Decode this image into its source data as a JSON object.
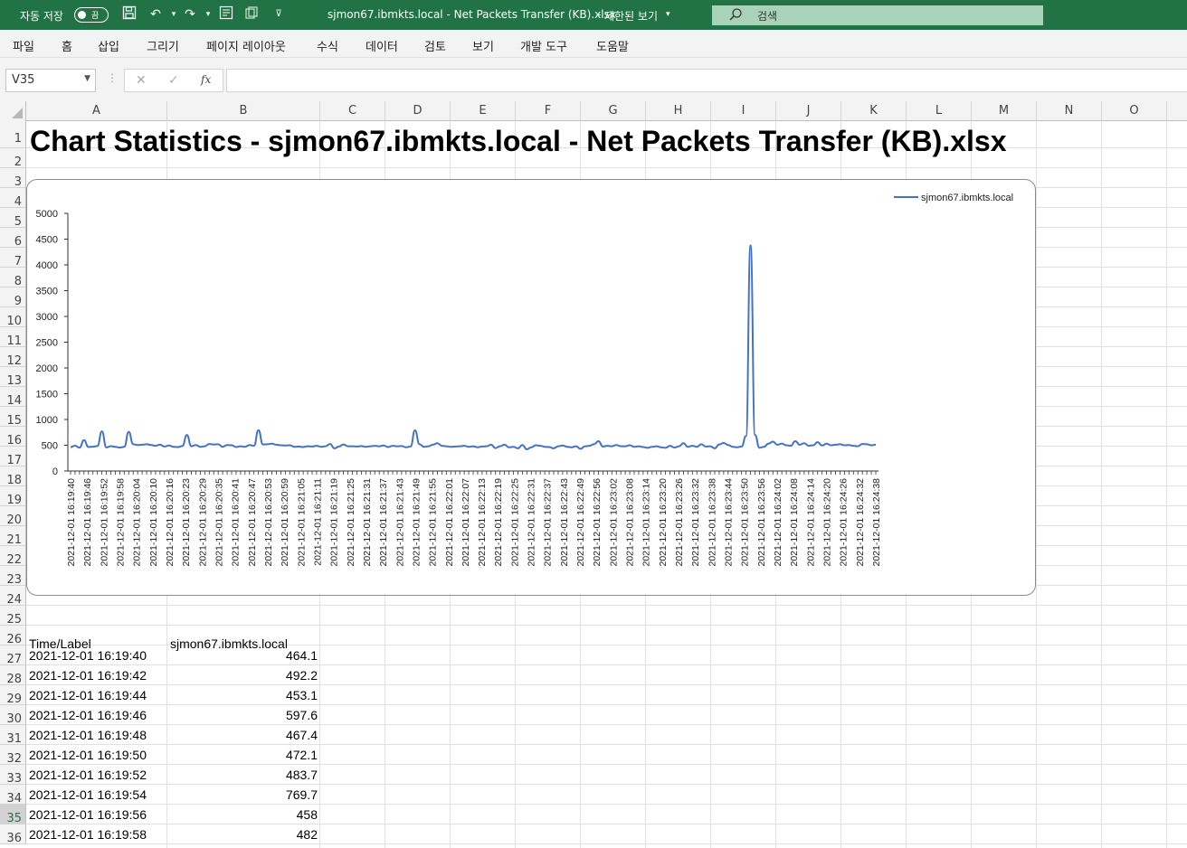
{
  "titlebar": {
    "autosave_label": "자동 저장",
    "autosave_state": "끔",
    "doc_title": "sjmon67.ibmkts.local - Net Packets Transfer (KB).xlsx",
    "view_mode": "제한된 보기",
    "search_placeholder": "검색",
    "bg_color": "#217346"
  },
  "menu": {
    "items": [
      "파일",
      "홈",
      "삽입",
      "그리기",
      "페이지 레이아웃",
      "수식",
      "데이터",
      "검토",
      "보기",
      "개발 도구",
      "도움말"
    ]
  },
  "formula_bar": {
    "name_box": "V35",
    "fx_label": "fx",
    "formula": ""
  },
  "sheet": {
    "columns": [
      "A",
      "B",
      "C",
      "D",
      "E",
      "F",
      "G",
      "H",
      "I",
      "J",
      "K",
      "L",
      "M",
      "N",
      "O"
    ],
    "rows": [
      "1",
      "2",
      "3",
      "4",
      "5",
      "6",
      "7",
      "8",
      "9",
      "10",
      "11",
      "12",
      "13",
      "14",
      "15",
      "16",
      "17",
      "18",
      "19",
      "20",
      "21",
      "22",
      "23",
      "24",
      "25",
      "26",
      "27",
      "28",
      "29",
      "30",
      "31",
      "32",
      "33",
      "34",
      "35",
      "36"
    ],
    "selected_row": "35",
    "title": "Chart Statistics - sjmon67.ibmkts.local - Net Packets Transfer (KB).xlsx",
    "table_header": {
      "time": "Time/Label",
      "series": "sjmon67.ibmkts.local"
    },
    "table_rows": [
      {
        "time": "2021-12-01 16:19:40",
        "value": "464.1"
      },
      {
        "time": "2021-12-01 16:19:42",
        "value": "492.2"
      },
      {
        "time": "2021-12-01 16:19:44",
        "value": "453.1"
      },
      {
        "time": "2021-12-01 16:19:46",
        "value": "597.6"
      },
      {
        "time": "2021-12-01 16:19:48",
        "value": "467.4"
      },
      {
        "time": "2021-12-01 16:19:50",
        "value": "472.1"
      },
      {
        "time": "2021-12-01 16:19:52",
        "value": "483.7"
      },
      {
        "time": "2021-12-01 16:19:54",
        "value": "769.7"
      },
      {
        "time": "2021-12-01 16:19:56",
        "value": "458"
      },
      {
        "time": "2021-12-01 16:19:58",
        "value": "482"
      }
    ]
  },
  "chart_data": {
    "type": "line",
    "series": [
      {
        "name": "sjmon67.ibmkts.local",
        "color": "#4472c4",
        "values": [
          464,
          492,
          453,
          598,
          467,
          472,
          484,
          770,
          458,
          482,
          470,
          455,
          470,
          760,
          520,
          505,
          510,
          520,
          505,
          490,
          510,
          475,
          495,
          470,
          465,
          485,
          700,
          480,
          505,
          470,
          480,
          525,
          515,
          520,
          470,
          505,
          500,
          465,
          480,
          470,
          505,
          490,
          795,
          515,
          520,
          530,
          510,
          500,
          495,
          500,
          470,
          475,
          465,
          480,
          475,
          490,
          470,
          480,
          525,
          440,
          475,
          515,
          480,
          480,
          475,
          485,
          470,
          480,
          490,
          480,
          495,
          465,
          490,
          480,
          485,
          460,
          475,
          790,
          520,
          470,
          480,
          510,
          540,
          490,
          480,
          470,
          475,
          480,
          490,
          470,
          480,
          460,
          475,
          480,
          510,
          445,
          480,
          510,
          460,
          470,
          440,
          505,
          420,
          460,
          500,
          490,
          470,
          465,
          440,
          480,
          495,
          470,
          460,
          480,
          430,
          480,
          490,
          520,
          580,
          475,
          490,
          480,
          505,
          480,
          480,
          500,
          470,
          480,
          465,
          450,
          470,
          480,
          460,
          450,
          490,
          455,
          480,
          540,
          470,
          490,
          470,
          520,
          475,
          480,
          440,
          515,
          545,
          505,
          470,
          460,
          475,
          680,
          4380,
          700,
          450,
          470,
          530,
          570,
          510,
          530,
          500,
          490,
          580,
          510,
          540,
          490,
          500,
          560,
          495,
          530,
          500,
          510,
          520,
          500,
          505,
          490,
          480,
          525,
          520,
          500,
          510
        ],
        "note": "values approximated from plot"
      }
    ],
    "x_first": "2021-12-01 16:19:40",
    "x_last": "2021-12-01 16:24:38",
    "x_tick_labels": [
      "2021-12-01 16:19:40",
      "2021-12-01 16:19:46",
      "2021-12-01 16:19:52",
      "2021-12-01 16:19:58",
      "2021-12-01 16:20:04",
      "2021-12-01 16:20:10",
      "2021-12-01 16:20:16",
      "2021-12-01 16:20:23",
      "2021-12-01 16:20:29",
      "2021-12-01 16:20:35",
      "2021-12-01 16:20:41",
      "2021-12-01 16:20:47",
      "2021-12-01 16:20:53",
      "2021-12-01 16:20:59",
      "2021-12-01 16:21:05",
      "2021-12-01 16:21:11",
      "2021-12-01 16:21:19",
      "2021-12-01 16:21:25",
      "2021-12-01 16:21:31",
      "2021-12-01 16:21:37",
      "2021-12-01 16:21:43",
      "2021-12-01 16:21:49",
      "2021-12-01 16:21:55",
      "2021-12-01 16:22:01",
      "2021-12-01 16:22:07",
      "2021-12-01 16:22:13",
      "2021-12-01 16:22:19",
      "2021-12-01 16:22:25",
      "2021-12-01 16:22:31",
      "2021-12-01 16:22:37",
      "2021-12-01 16:22:43",
      "2021-12-01 16:22:49",
      "2021-12-01 16:22:56",
      "2021-12-01 16:23:02",
      "2021-12-01 16:23:08",
      "2021-12-01 16:23:14",
      "2021-12-01 16:23:20",
      "2021-12-01 16:23:26",
      "2021-12-01 16:23:32",
      "2021-12-01 16:23:38",
      "2021-12-01 16:23:44",
      "2021-12-01 16:23:50",
      "2021-12-01 16:23:56",
      "2021-12-01 16:24:02",
      "2021-12-01 16:24:08",
      "2021-12-01 16:24:14",
      "2021-12-01 16:24:20",
      "2021-12-01 16:24:26",
      "2021-12-01 16:24:32",
      "2021-12-01 16:24:38"
    ],
    "y_ticks": [
      0,
      500,
      1000,
      1500,
      2000,
      2500,
      3000,
      3500,
      4000,
      4500,
      5000
    ],
    "ylim": [
      0,
      5000
    ],
    "legend": "top-right",
    "grid": false
  }
}
